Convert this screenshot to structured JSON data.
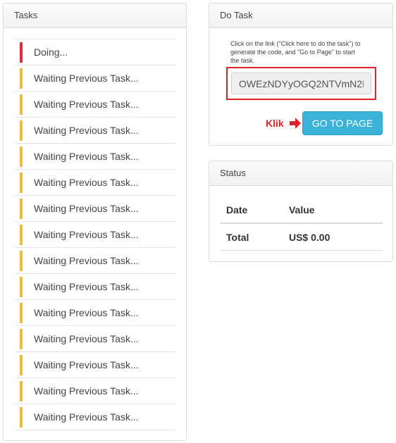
{
  "tasks_panel": {
    "title": "Tasks",
    "items": [
      {
        "label": "Doing...",
        "status": "doing",
        "color": "#e0293b"
      },
      {
        "label": "Waiting Previous Task...",
        "status": "waiting",
        "color": "#f5b740"
      },
      {
        "label": "Waiting Previous Task...",
        "status": "waiting",
        "color": "#f5b740"
      },
      {
        "label": "Waiting Previous Task...",
        "status": "waiting",
        "color": "#f5b740"
      },
      {
        "label": "Waiting Previous Task...",
        "status": "waiting",
        "color": "#f5b740"
      },
      {
        "label": "Waiting Previous Task...",
        "status": "waiting",
        "color": "#f5b740"
      },
      {
        "label": "Waiting Previous Task...",
        "status": "waiting",
        "color": "#f5b740"
      },
      {
        "label": "Waiting Previous Task...",
        "status": "waiting",
        "color": "#f5b740"
      },
      {
        "label": "Waiting Previous Task...",
        "status": "waiting",
        "color": "#f5b740"
      },
      {
        "label": "Waiting Previous Task...",
        "status": "waiting",
        "color": "#f5b740"
      },
      {
        "label": "Waiting Previous Task...",
        "status": "waiting",
        "color": "#f5b740"
      },
      {
        "label": "Waiting Previous Task...",
        "status": "waiting",
        "color": "#f5b740"
      },
      {
        "label": "Waiting Previous Task...",
        "status": "waiting",
        "color": "#f5b740"
      },
      {
        "label": "Waiting Previous Task...",
        "status": "waiting",
        "color": "#f5b740"
      },
      {
        "label": "Waiting Previous Task...",
        "status": "waiting",
        "color": "#f5b740"
      }
    ]
  },
  "do_task_panel": {
    "title": "Do Task",
    "instructions": "Click on the link (\"Click here to do the task\") to generate the code, and \"Go to Page\" to start the task.",
    "code_value": "OWEzNDYyOGQ2NTVmN2I",
    "klik_label": "Klik",
    "klik_arrow_icon": "arrow-right-icon",
    "go_button_label": "GO TO PAGE",
    "accent_color": "#3bb3d8",
    "highlight_color": "#e0202a"
  },
  "status_panel": {
    "title": "Status",
    "columns": [
      "Date",
      "Value"
    ],
    "total_label": "Total",
    "total_value": "US$ 0.00"
  }
}
